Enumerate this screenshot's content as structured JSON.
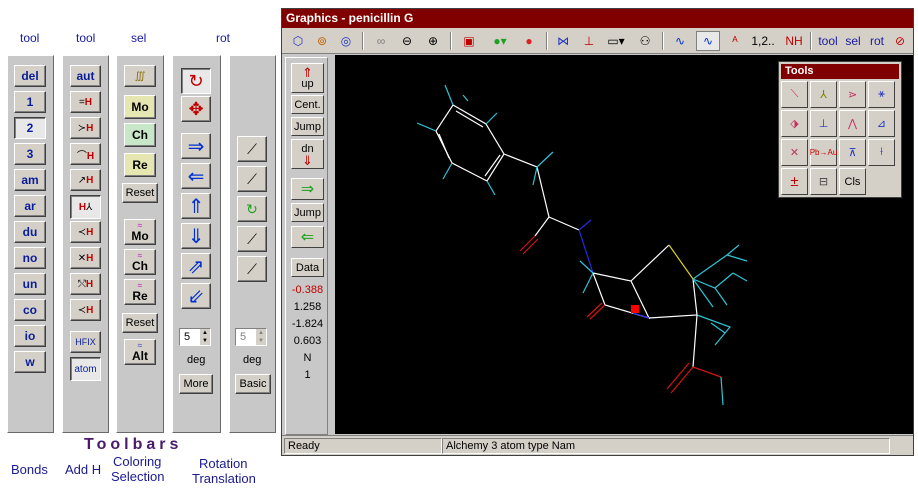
{
  "headers": {
    "bonds": "tool",
    "addh": "tool",
    "sel": "sel",
    "rot": "rot"
  },
  "bonds": [
    "del",
    "1",
    "2",
    "3",
    "am",
    "ar",
    "du",
    "no",
    "un",
    "co",
    "io",
    "w"
  ],
  "addh_top": "aut",
  "addh_bottom": [
    "HFIX",
    "atom"
  ],
  "coloring": {
    "mo": "Mo",
    "ch": "Ch",
    "re": "Re",
    "reset": "Reset",
    "alt": "Alt"
  },
  "rotation": {
    "spin": "5",
    "deg": "deg",
    "more": "More"
  },
  "translation": {
    "spin": "5",
    "deg": "deg",
    "basic": "Basic"
  },
  "captions": {
    "toolbars": "Toolbars",
    "bonds": "Bonds",
    "addh": "Add H",
    "coloring": "Coloring",
    "selection": "Selection",
    "rotation": "Rotation",
    "translation": "Translation"
  },
  "graphics": {
    "title": "Graphics - penicillin G",
    "toolbar": {
      "num": "1,2..",
      "nh": "NH",
      "tool": "tool",
      "sel": "sel",
      "rot": "rot"
    },
    "left": {
      "up": "up",
      "cent": "Cent.",
      "jump1": "Jump",
      "dn": "dn",
      "jump2": "Jump",
      "data": "Data"
    },
    "values": [
      "-0.388",
      "1.258",
      "-1.824",
      "0.603",
      "N",
      "1"
    ],
    "status": {
      "ready": "Ready",
      "atom": "Alchemy 3 atom type Nam"
    },
    "tools": {
      "title": "Tools",
      "pb": "Pb→Au",
      "cls": "Cls"
    }
  },
  "colors": {
    "title_bar": "#800000",
    "canvas": "#000000",
    "bond_white": "#ffffff",
    "carbon_h": "#2ec4d6",
    "oxygen": "#d21414",
    "nitrogen": "#2828e6",
    "sulfur": "#e0d020",
    "accent_blue": "#0a1e9a"
  }
}
